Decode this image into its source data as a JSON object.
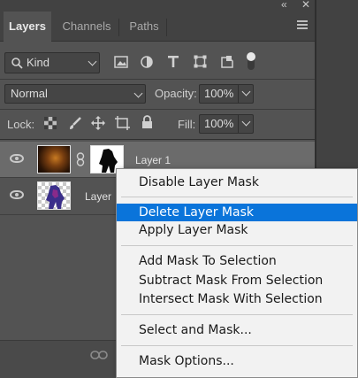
{
  "window": {
    "collapse_glyph": "«",
    "close_glyph": "✕"
  },
  "tabs": [
    {
      "label": "Layers",
      "active": true
    },
    {
      "label": "Channels",
      "active": false
    },
    {
      "label": "Paths",
      "active": false
    }
  ],
  "filter": {
    "kind_label": "Kind",
    "icons": [
      "search-icon",
      "image-filter-icon",
      "adjustment-filter-icon",
      "type-filter-icon",
      "shape-filter-icon",
      "smart-object-filter-icon",
      "filter-toggle-icon"
    ]
  },
  "blend": {
    "mode": "Normal",
    "opacity_label": "Opacity:",
    "opacity_value": "100%"
  },
  "lock": {
    "label": "Lock:",
    "icons": [
      "lock-transparent-pixels-icon",
      "lock-image-pixels-icon",
      "lock-position-icon",
      "lock-artboard-icon",
      "lock-all-icon"
    ],
    "fill_label": "Fill:",
    "fill_value": "100%"
  },
  "layers": [
    {
      "name": "Layer 1",
      "selected": true,
      "has_mask": true
    },
    {
      "name": "Layer",
      "selected": false,
      "has_mask": false
    }
  ],
  "bottom": {
    "icons": [
      "link-layers-icon"
    ]
  },
  "context_menu": {
    "items": [
      {
        "label": "Disable Layer Mask",
        "highlighted": false
      },
      {
        "label": "Delete Layer Mask",
        "highlighted": true
      },
      {
        "label": "Apply Layer Mask",
        "highlighted": false
      },
      {
        "label": "Add Mask To Selection",
        "highlighted": false
      },
      {
        "label": "Subtract Mask From Selection",
        "highlighted": false
      },
      {
        "label": "Intersect Mask With Selection",
        "highlighted": false
      },
      {
        "label": "Select and Mask...",
        "highlighted": false
      },
      {
        "label": "Mask Options...",
        "highlighted": false
      }
    ]
  },
  "colors": {
    "panel_bg": "#535353",
    "tabbar_bg": "#424242",
    "selected_layer": "#6b6b6b",
    "menu_bg": "#f2f2f2",
    "menu_highlight": "#0a74da"
  }
}
